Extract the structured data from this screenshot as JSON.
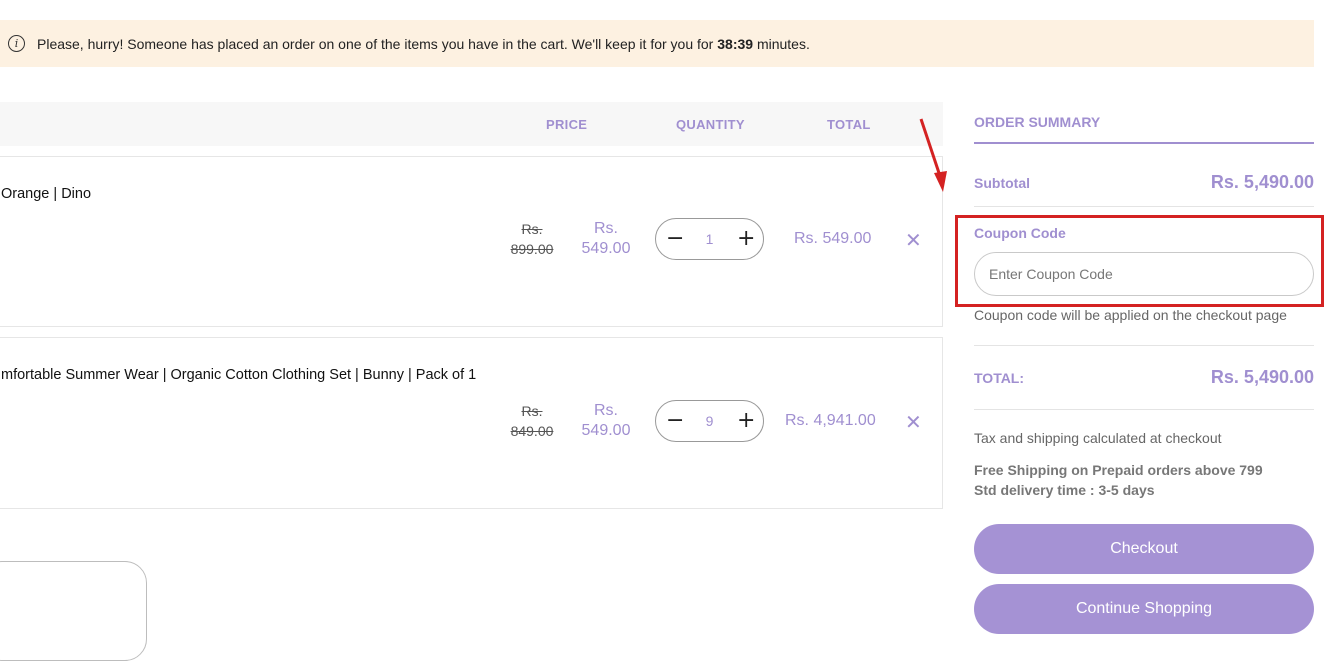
{
  "banner": {
    "icon": "info-icon",
    "message_before": "Please, hurry! Someone has placed an order on one of the items you have in the cart. We'll keep it for you for ",
    "timer": "38:39",
    "message_after": " minutes."
  },
  "table": {
    "headers": {
      "price": "PRICE",
      "quantity": "QUANTITY",
      "total": "TOTAL"
    }
  },
  "items": [
    {
      "name": "Orange | Dino",
      "old_price_label": "Rs.",
      "old_price_value": "899.00",
      "new_price_label": "Rs.",
      "new_price_value": "549.00",
      "quantity": "1",
      "minus": "−",
      "plus": "+",
      "total": "Rs. 549.00",
      "remove": "✕"
    },
    {
      "name": "mfortable Summer Wear | Organic Cotton Clothing Set | Bunny | Pack of 1",
      "old_price_label": "Rs.",
      "old_price_value": "849.00",
      "new_price_label": "Rs.",
      "new_price_value": "549.00",
      "quantity": "9",
      "minus": "−",
      "plus": "+",
      "total": "Rs. 4,941.00",
      "remove": "✕"
    }
  ],
  "summary": {
    "title": "ORDER SUMMARY",
    "subtotal_label": "Subtotal",
    "subtotal_value": "Rs. 5,490.00",
    "coupon_label": "Coupon Code",
    "coupon_placeholder": "Enter Coupon Code",
    "coupon_note": "Coupon code will be applied on the checkout page",
    "total_label": "TOTAL:",
    "total_value": "Rs. 5,490.00",
    "tax_note": "Tax and shipping calculated at checkout",
    "shipping_line1": "Free Shipping on Prepaid orders above 799",
    "shipping_line2": "Std delivery time : 3-5 days",
    "checkout_label": "Checkout",
    "continue_label": "Continue Shopping"
  },
  "colors": {
    "accent": "#a08fd0",
    "button": "#a592d4",
    "banner_bg": "#fdf1e1",
    "highlight": "#d42222"
  }
}
